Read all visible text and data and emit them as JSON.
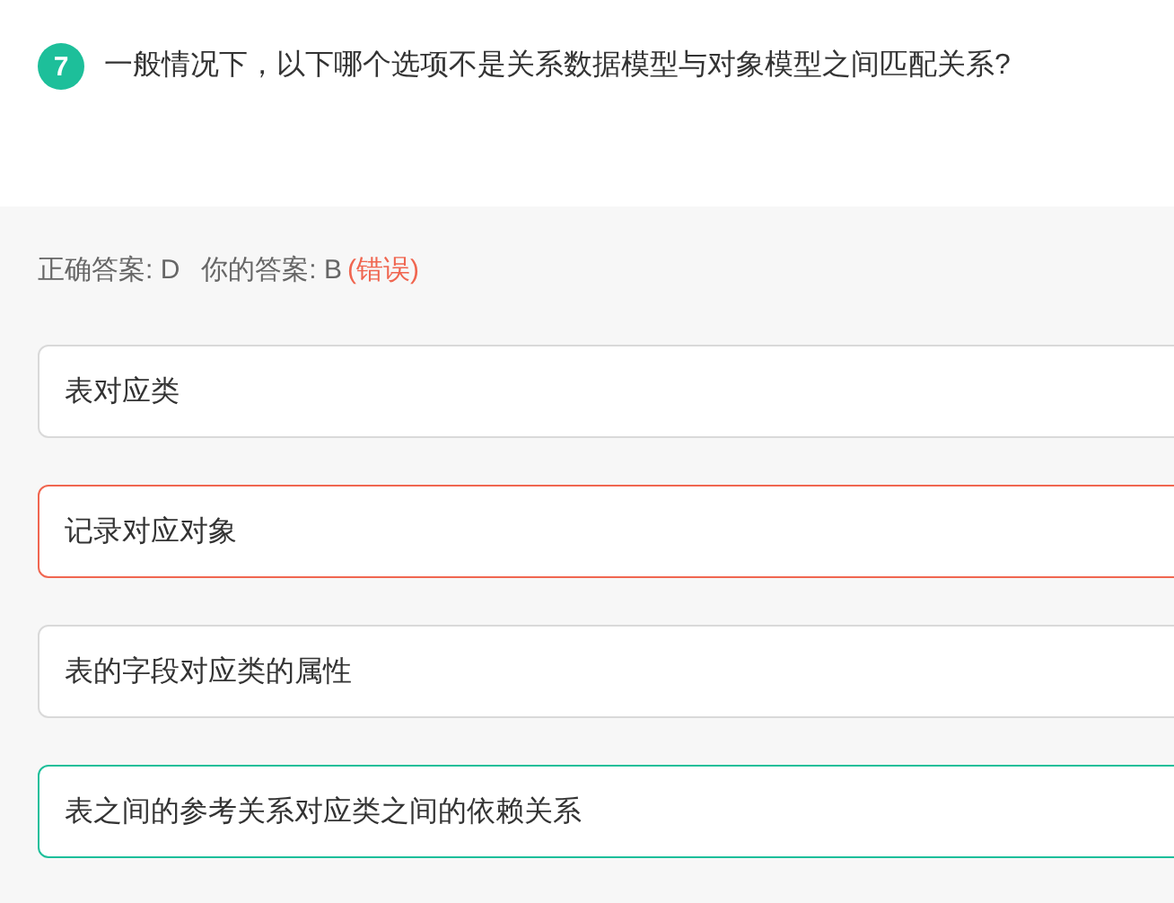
{
  "question": {
    "number": "7",
    "text": "一般情况下，以下哪个选项不是关系数据模型与对象模型之间匹配关系?"
  },
  "answer": {
    "correct": "正确答案: D",
    "yours": "你的答案: B",
    "verdict": "(错误)"
  },
  "options": [
    {
      "text": "表对应类",
      "selected": false,
      "correct": false
    },
    {
      "text": "记录对应对象",
      "selected": true,
      "correct": false
    },
    {
      "text": "表的字段对应类的属性",
      "selected": false,
      "correct": false
    },
    {
      "text": "表之间的参考关系对应类之间的依赖关系",
      "selected": false,
      "correct": true
    }
  ]
}
